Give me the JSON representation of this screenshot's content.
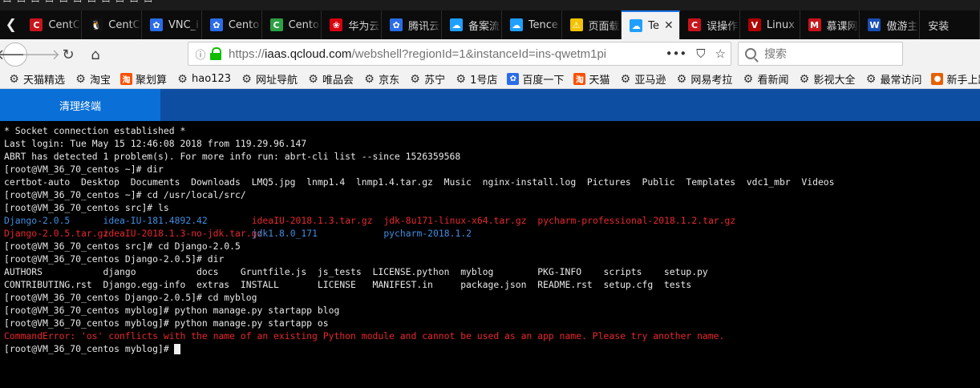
{
  "tabs": [
    {
      "label": "CentC",
      "icon": "centos-red-icon",
      "color": "#c8151b",
      "glyph": "C"
    },
    {
      "label": "CentC",
      "icon": "penguin-icon",
      "color": "#111111",
      "glyph": "🐧"
    },
    {
      "label": "VNC_i",
      "icon": "baidu-paw-icon",
      "color": "#2b6ce8",
      "glyph": "✿"
    },
    {
      "label": "Cento",
      "icon": "baidu-paw-icon",
      "color": "#2b6ce8",
      "glyph": "✿"
    },
    {
      "label": "Cento",
      "icon": "centos-green-icon",
      "color": "#2ea043",
      "glyph": "C"
    },
    {
      "label": "华为云",
      "icon": "huawei-icon",
      "color": "#d7000f",
      "glyph": "❀"
    },
    {
      "label": "腾讯云",
      "icon": "tencent-icon",
      "color": "#2b6ce8",
      "glyph": "✿"
    },
    {
      "label": "备案流",
      "icon": "cloud-icon",
      "color": "#1fa0ff",
      "glyph": "☁"
    },
    {
      "label": "Tence",
      "icon": "cloud-icon",
      "color": "#1fa0ff",
      "glyph": "☁"
    },
    {
      "label": "页面载",
      "icon": "warning-icon",
      "color": "#f2c200",
      "glyph": "⚠"
    },
    {
      "label": "Te",
      "icon": "cloud-icon",
      "color": "#1fa0ff",
      "glyph": "☁",
      "active": true
    },
    {
      "label": "误操作",
      "icon": "csdn-icon",
      "color": "#c8151b",
      "glyph": "C"
    },
    {
      "label": "Linux",
      "icon": "vps-icon",
      "color": "#b00000",
      "glyph": "V"
    },
    {
      "label": "慕课网",
      "icon": "mooc-icon",
      "color": "#c8151b",
      "glyph": "M"
    },
    {
      "label": "傲游主",
      "icon": "maxthon-icon",
      "color": "#1a4fb5",
      "glyph": "W"
    },
    {
      "label": "安装",
      "icon": "none",
      "color": "#0c0c0c",
      "glyph": ""
    }
  ],
  "active_tab_close": "✕",
  "address": {
    "prefix": "https://",
    "domain": "iaas.qcloud.com",
    "path": "/webshell?regionId=1&instanceId=ins-qwetm1pi"
  },
  "search": {
    "placeholder": "搜索"
  },
  "bookmarks": [
    {
      "label": "天猫精选",
      "icon": "gear-icon",
      "color": "#333333",
      "glyph": "⚙"
    },
    {
      "label": "淘宝",
      "icon": "gear-icon",
      "color": "#333333",
      "glyph": "⚙"
    },
    {
      "label": "聚划算",
      "icon": "taobao-icon",
      "color": "#ff5000",
      "glyph": "淘"
    },
    {
      "label": "hao123",
      "icon": "gear-icon",
      "color": "#333333",
      "glyph": "⚙"
    },
    {
      "label": "网址导航",
      "icon": "gear-icon",
      "color": "#333333",
      "glyph": "⚙"
    },
    {
      "label": "唯品会",
      "icon": "gear-icon",
      "color": "#333333",
      "glyph": "⚙"
    },
    {
      "label": "京东",
      "icon": "gear-icon",
      "color": "#333333",
      "glyph": "⚙"
    },
    {
      "label": "苏宁",
      "icon": "gear-icon",
      "color": "#333333",
      "glyph": "⚙"
    },
    {
      "label": "1号店",
      "icon": "gear-icon",
      "color": "#333333",
      "glyph": "⚙"
    },
    {
      "label": "百度一下",
      "icon": "baidu-paw-icon",
      "color": "#2b6ce8",
      "glyph": "✿"
    },
    {
      "label": "天猫",
      "icon": "taobao-icon",
      "color": "#ff5000",
      "glyph": "淘"
    },
    {
      "label": "亚马逊",
      "icon": "gear-icon",
      "color": "#333333",
      "glyph": "⚙"
    },
    {
      "label": "网易考拉",
      "icon": "gear-icon",
      "color": "#333333",
      "glyph": "⚙"
    },
    {
      "label": "看新闻",
      "icon": "gear-icon",
      "color": "#333333",
      "glyph": "⚙"
    },
    {
      "label": "影视大全",
      "icon": "gear-icon",
      "color": "#333333",
      "glyph": "⚙"
    },
    {
      "label": "最常访问",
      "icon": "gear-icon",
      "color": "#333333",
      "glyph": "⚙"
    },
    {
      "label": "新手上路",
      "icon": "firefox-icon",
      "color": "#e66000",
      "glyph": "●"
    }
  ],
  "shell_header": {
    "clear_button": "清理终端"
  },
  "terminal": {
    "lines": [
      [
        {
          "t": "* Socket connection established *"
        }
      ],
      [
        {
          "t": "Last login: Tue May 15 12:46:08 2018 from 119.29.96.147"
        }
      ],
      [
        {
          "t": "ABRT has detected 1 problem(s). For more info run: abrt-cli list --since 1526359568"
        }
      ],
      [
        {
          "t": "[root@VM_36_70_centos ~]# dir"
        }
      ],
      [
        {
          "t": "certbot-auto  Desktop  Documents  Downloads  LMQ5.jpg  lnmp1.4  lnmp1.4.tar.gz  Music  nginx-install.log  Pictures  Public  Templates  vdc1_mbr  Videos"
        }
      ],
      [
        {
          "t": "[root@VM_36_70_centos ~]# cd /usr/local/src/"
        }
      ],
      [
        {
          "t": "[root@VM_36_70_centos src]# ls"
        }
      ],
      [
        {
          "t": "Django-2.0.5",
          "c": "blue",
          "w": 18
        },
        {
          "t": "idea-IU-181.4892.42",
          "c": "blue",
          "w": 27
        },
        {
          "t": "ideaIU-2018.1.3.tar.gz",
          "c": "red",
          "w": 24
        },
        {
          "t": "jdk-8u171-linux-x64.tar.gz",
          "c": "red",
          "w": 28
        },
        {
          "t": "pycharm-professional-2018.1.2.tar.gz",
          "c": "red"
        }
      ],
      [
        {
          "t": "Django-2.0.5.tar.gz",
          "c": "red",
          "w": 18
        },
        {
          "t": "ideaIU-2018.1.3-no-jdk.tar.gz",
          "c": "red",
          "w": 27
        },
        {
          "t": "jdk1.8.0_171",
          "c": "blue",
          "w": 24
        },
        {
          "t": "pycharm-2018.1.2",
          "c": "blue"
        }
      ],
      [
        {
          "t": "[root@VM_36_70_centos src]# cd Django-2.0.5"
        }
      ],
      [
        {
          "t": "[root@VM_36_70_centos Django-2.0.5]# dir"
        }
      ],
      [
        {
          "t": "AUTHORS           django           docs    Gruntfile.js  js_tests  LICENSE.python  myblog        PKG-INFO    scripts    setup.py"
        }
      ],
      [
        {
          "t": "CONTRIBUTING.rst  Django.egg-info  extras  INSTALL       LICENSE   MANIFEST.in     package.json  README.rst  setup.cfg  tests"
        }
      ],
      [
        {
          "t": "[root@VM_36_70_centos Django-2.0.5]# cd myblog"
        }
      ],
      [
        {
          "t": "[root@VM_36_70_centos myblog]# python manage.py startapp blog"
        }
      ],
      [
        {
          "t": "[root@VM_36_70_centos myblog]# python manage.py startapp os"
        }
      ],
      [
        {
          "t": "CommandError: 'os' conflicts with the name of an existing Python module and cannot be used as an app name. Please try another name.",
          "c": "red"
        }
      ],
      [
        {
          "t": "[root@VM_36_70_centos myblog]#"
        }
      ]
    ]
  }
}
